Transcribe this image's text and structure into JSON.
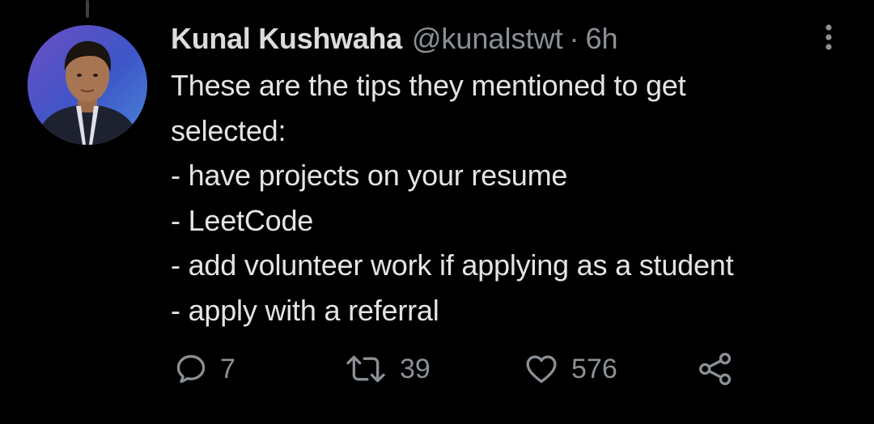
{
  "colors": {
    "background": "#000000",
    "text_primary": "#e4e4e4",
    "text_secondary": "#8b9096",
    "thread_line": "#3e4144"
  },
  "tweet": {
    "author_name": "Kunal Kushwaha",
    "author_handle": "@kunalstwt",
    "separator": "·",
    "timestamp": "6h",
    "text_lines": [
      "These are the tips they mentioned to get",
      "selected:",
      "- have projects on your resume",
      "- LeetCode",
      "- add volunteer work if applying as a student",
      "- apply with a referral"
    ]
  },
  "actions": {
    "reply": {
      "icon": "reply-icon",
      "count": "7"
    },
    "retweet": {
      "icon": "retweet-icon",
      "count": "39"
    },
    "like": {
      "icon": "heart-icon",
      "count": "576"
    },
    "share": {
      "icon": "share-icon"
    }
  },
  "menu": {
    "icon": "more-options-icon"
  }
}
